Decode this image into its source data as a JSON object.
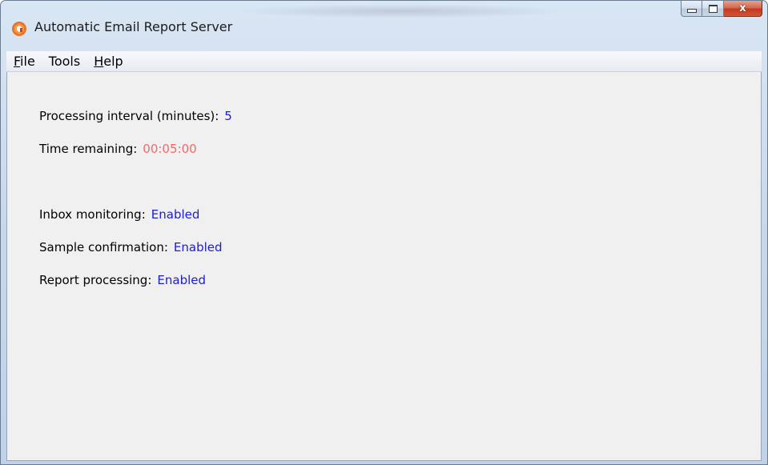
{
  "window": {
    "title": "Automatic Email Report Server",
    "icon": "app-logo-icon",
    "controls": {
      "minimize": "minimize-icon",
      "maximize": "maximize-icon",
      "close": "close-icon",
      "close_glyph": "x"
    }
  },
  "menu": {
    "file": {
      "mnemonic": "F",
      "rest": "ile"
    },
    "tools": {
      "label": "Tools"
    },
    "help": {
      "mnemonic": "H",
      "rest": "elp"
    }
  },
  "status": {
    "interval_label": "Processing interval (minutes):",
    "interval_value": "5",
    "remaining_label": "Time remaining:",
    "remaining_value": "00:05:00",
    "inbox_label": "Inbox monitoring:",
    "inbox_value": "Enabled",
    "confirmation_label": "Sample confirmation:",
    "confirmation_value": "Enabled",
    "report_label": "Report processing:",
    "report_value": "Enabled"
  },
  "colors": {
    "value_blue": "#1b1bd8",
    "value_red": "#f06a6a",
    "client_bg": "#f0f0f0",
    "frame_blue": "#c9d9ec"
  }
}
